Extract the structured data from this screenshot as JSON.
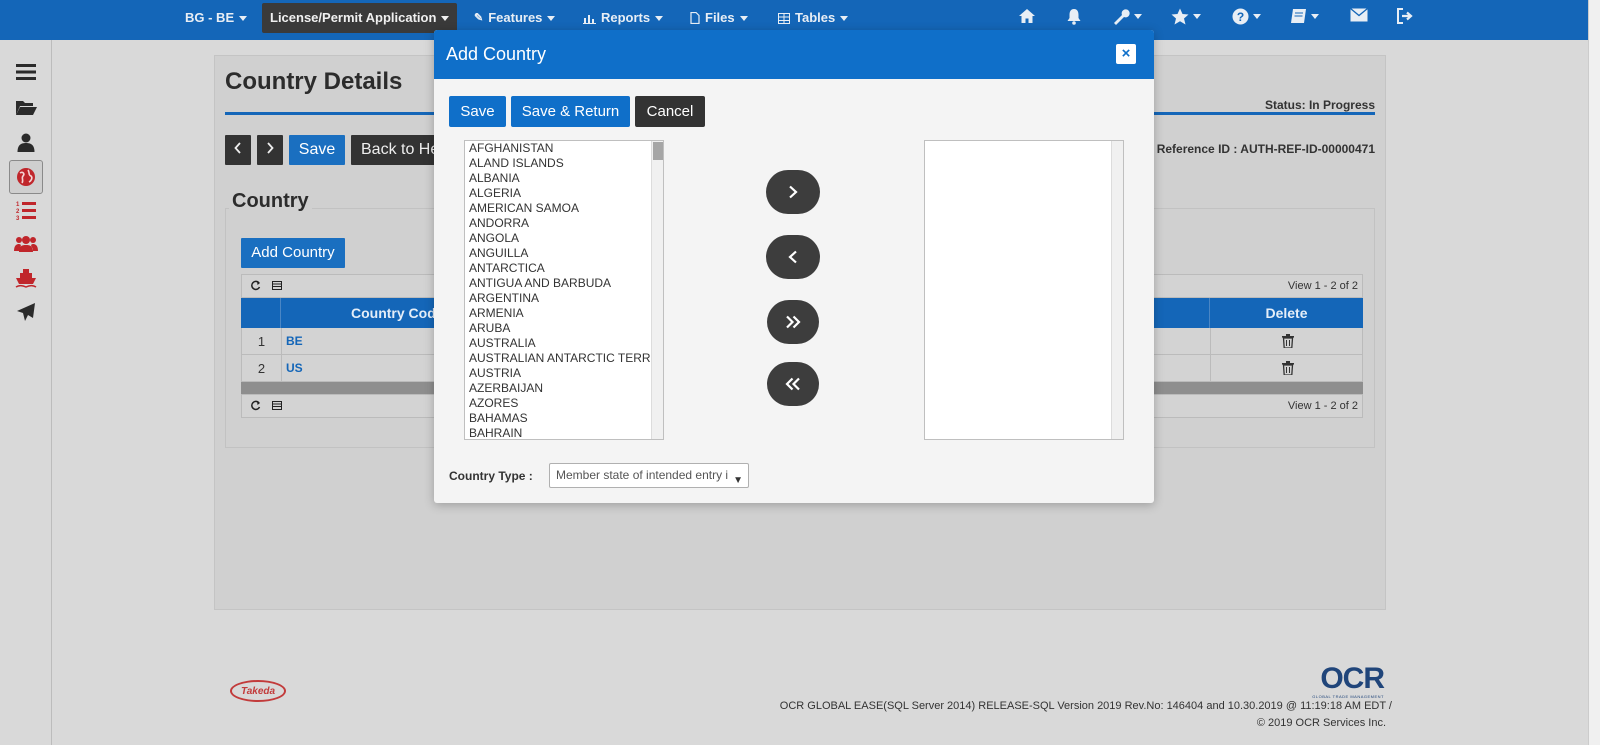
{
  "topnav": {
    "company": "BG - BE",
    "module": "License/Permit Application",
    "menus": [
      "Features",
      "Reports",
      "Files",
      "Tables"
    ]
  },
  "page": {
    "title": "Country Details",
    "status": "Status: In Progress",
    "reference": "Reference ID : AUTH-REF-ID-00000471",
    "save_label": "Save",
    "back_label": "Back to He",
    "section_title": "Country",
    "add_country_label": "Add Country",
    "view_text": "View 1 - 2 of 2",
    "columns": {
      "code": "Country Cod",
      "delete": "Delete"
    },
    "rows": [
      {
        "num": "1",
        "code": "BE"
      },
      {
        "num": "2",
        "code": "US"
      }
    ]
  },
  "footer": {
    "client_logo": "Takeda",
    "vendor_logo": "OCR",
    "vendor_tagline": "GLOBAL TRADE MANAGEMENT",
    "version": "OCR GLOBAL EASE(SQL Server 2014) RELEASE-SQL Version 2019 Rev.No: 146404 and 10.30.2019 @ 11:19:18 AM EDT  /",
    "copyright": "© 2019 OCR Services Inc."
  },
  "modal": {
    "title": "Add Country",
    "close": "×",
    "save_label": "Save",
    "save_return_label": "Save & Return",
    "cancel_label": "Cancel",
    "available_countries": [
      "AFGHANISTAN",
      "ALAND ISLANDS",
      "ALBANIA",
      "ALGERIA",
      "AMERICAN SAMOA",
      "ANDORRA",
      "ANGOLA",
      "ANGUILLA",
      "ANTARCTICA",
      "ANTIGUA AND BARBUDA",
      "ARGENTINA",
      "ARMENIA",
      "ARUBA",
      "AUSTRALIA",
      "AUSTRALIAN ANTARCTIC TERR",
      "AUSTRIA",
      "AZERBAIJAN",
      "AZORES",
      "BAHAMAS",
      "BAHRAIN"
    ],
    "country_type_label": "Country Type :",
    "country_type_value": "Member state of intended entry i"
  },
  "colors": {
    "nav": "#1466b8",
    "modal_header": "#0f6fc9",
    "button_blue": "#1a6fc0",
    "button_dark": "#333333"
  }
}
